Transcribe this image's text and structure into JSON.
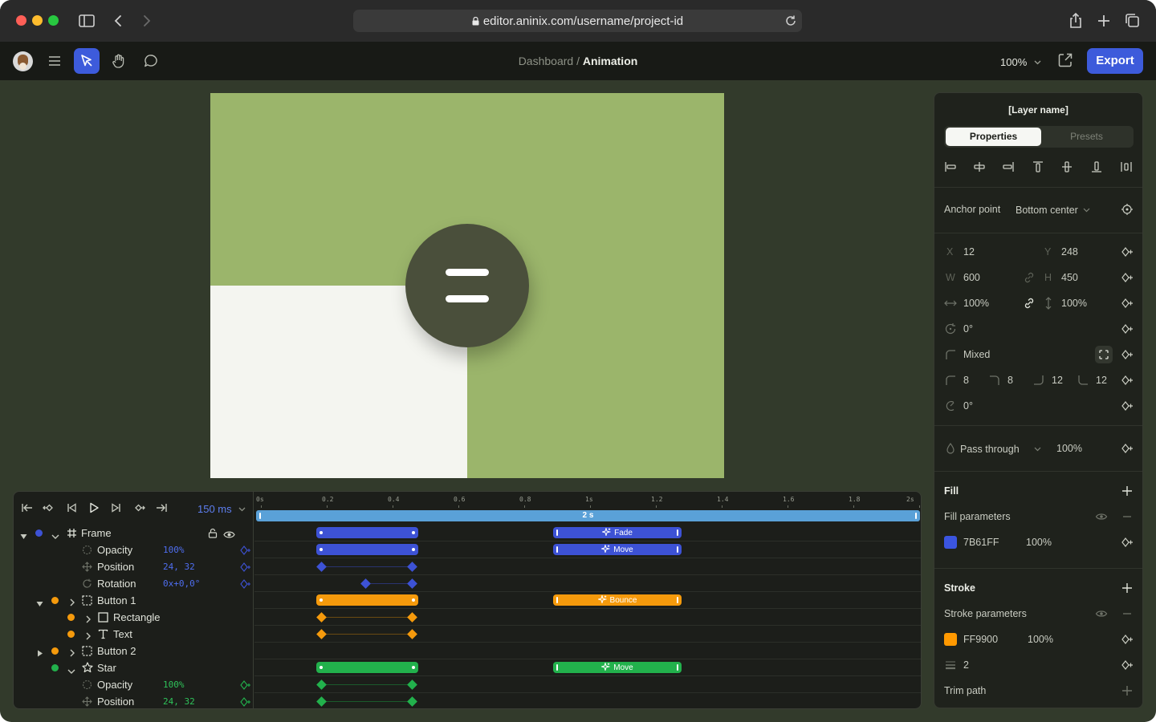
{
  "browser": {
    "url": "editor.aninix.com/username/project-id"
  },
  "toolbar": {
    "breadcrumb_parent": "Dashboard",
    "breadcrumb_sep": " / ",
    "breadcrumb_current": "Animation",
    "zoom": "100%",
    "export_label": "Export"
  },
  "timeline": {
    "speed": "150 ms",
    "ticks": [
      "0s",
      "0.2",
      "0.4",
      "0.6",
      "0.8",
      "1s",
      "1.2",
      "1.4",
      "1.6",
      "1.8",
      "2s"
    ],
    "duration_label": "2 s",
    "layers": [
      {
        "label": "Frame"
      },
      {
        "label": "Opacity",
        "value": "100%"
      },
      {
        "label": "Position",
        "value": "24, 32"
      },
      {
        "label": "Rotation",
        "value": "0x+0,0°"
      },
      {
        "label": "Button 1"
      },
      {
        "label": "Rectangle"
      },
      {
        "label": "Text"
      },
      {
        "label": "Button 2"
      },
      {
        "label": "Star"
      },
      {
        "label": "Opacity",
        "value": "100%"
      },
      {
        "label": "Position",
        "value": "24, 32"
      }
    ],
    "clips": {
      "fade": "Fade",
      "move": "Move",
      "bounce": "Bounce",
      "star_move": "Move"
    },
    "colors": {
      "blue": "#3d52d5",
      "orange": "#f59a0c",
      "green": "#22b14c"
    }
  },
  "panel": {
    "layer_name": "[Layer name]",
    "tabs": {
      "properties": "Properties",
      "presets": "Presets"
    },
    "anchor_label": "Anchor point",
    "anchor_value": "Bottom center",
    "x_label": "X",
    "x_value": "12",
    "y_label": "Y",
    "y_value": "248",
    "w_label": "W",
    "w_value": "600",
    "h_label": "H",
    "h_value": "450",
    "scale_x": "100%",
    "scale_y": "100%",
    "rotation": "0°",
    "corner_mode": "Mixed",
    "radius_tl": "8",
    "radius_tr": "8",
    "radius_br": "12",
    "radius_bl": "12",
    "skew": "0°",
    "blend_mode": "Pass through",
    "layer_opacity": "100%",
    "fill_title": "Fill",
    "fill_params": "Fill parameters",
    "fill_hex": "7B61FF",
    "fill_opacity": "100%",
    "fill_color": "#3b55e0",
    "stroke_title": "Stroke",
    "stroke_params": "Stroke parameters",
    "stroke_hex": "FF9900",
    "stroke_opacity": "100%",
    "stroke_color": "#ff9900",
    "stroke_width": "2",
    "trim_path": "Trim path"
  }
}
